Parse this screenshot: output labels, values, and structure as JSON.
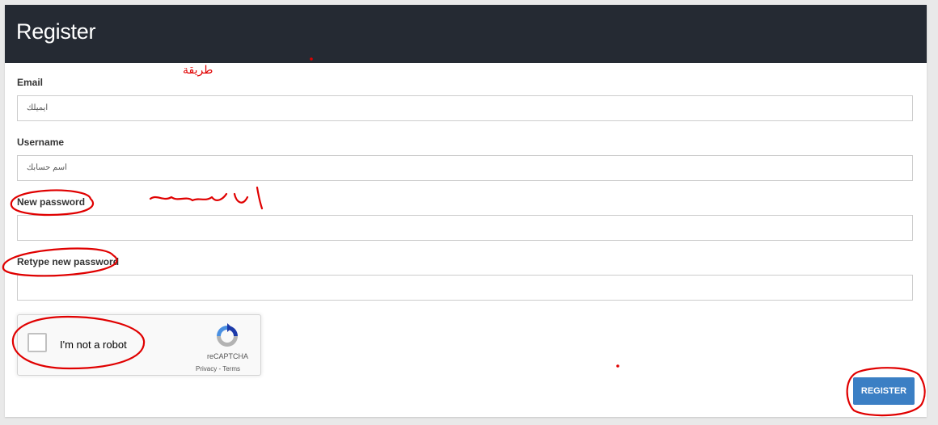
{
  "header": {
    "title": "Register"
  },
  "form": {
    "email": {
      "label": "Email",
      "value": "ايميلك"
    },
    "username": {
      "label": "Username",
      "value": "اسم حسابك"
    },
    "new_password": {
      "label": "New password",
      "value": ""
    },
    "retype_password": {
      "label": "Retype new password",
      "value": ""
    }
  },
  "recaptcha": {
    "label": "I'm not a robot",
    "brand": "reCAPTCHA",
    "privacy": "Privacy",
    "separator": " - ",
    "terms": "Terms"
  },
  "register_button": {
    "label": "REGISTER"
  },
  "annotations": {
    "note_text": "طريقة",
    "color": "#e00000"
  }
}
